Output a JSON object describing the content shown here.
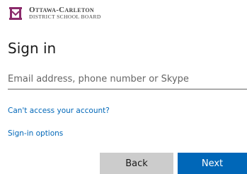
{
  "logo": {
    "icon": "ocdsb-crest-icon",
    "line1": "Ottawa-Carleton",
    "line2": "District School Board",
    "color": "#8b2a6b"
  },
  "page": {
    "title": "Sign in"
  },
  "email": {
    "value": "",
    "placeholder": "Email address, phone number or Skype"
  },
  "links": {
    "cant_access": "Can't access your account?",
    "signin_options": "Sign-in options"
  },
  "buttons": {
    "back": "Back",
    "next": "Next"
  },
  "colors": {
    "accent": "#0067b8",
    "back_button": "#cccccc"
  }
}
